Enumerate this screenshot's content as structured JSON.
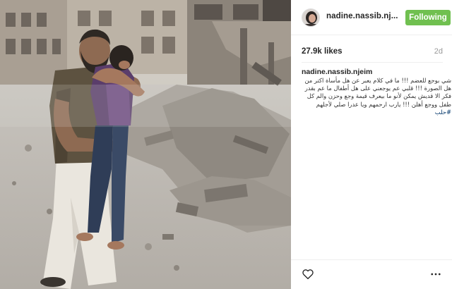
{
  "header": {
    "username": "nadine.nassib.nj...",
    "follow_label": "Following"
  },
  "stats": {
    "likes": "27.9k likes",
    "age": "2d"
  },
  "caption": {
    "username": "nadine.nassib.njeim",
    "text": "شي بوجع للعضم !!! ما في كلام يعبر عن هل مأساة اكتر من هل الصورة !!! قلبي عم يوجعني على هل أطفال ما عم بقدر فكر الا قديش يمكن لأنو ما بيعرف قيمة وجع وحزن والم كل طفل ووجع أهلن !!! يارب ارحمهم ويا عدرا صلي لأجلهم",
    "hashtag": "#حلب"
  },
  "icons": {
    "heart": "heart-icon",
    "more": "more-options-icon",
    "avatar": "avatar"
  },
  "colors": {
    "follow_button": "#70c050",
    "hashtag": "#003569"
  }
}
